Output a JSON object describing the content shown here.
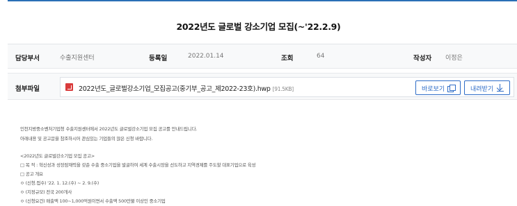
{
  "post": {
    "title": "2022년도 글로벌 강소기업 모집(~'22.2.9)"
  },
  "info": {
    "dept_label": "담당부서",
    "dept_value": "수출지원센터",
    "date_label": "등록일",
    "date_value": "2022.01.14",
    "views_label": "조회",
    "views_value": "64",
    "author_label": "작성자",
    "author_value": "이정은"
  },
  "attachment": {
    "label": "첨부파일",
    "file_name": "2022년도_글로벌강소기업_모집공고(중기부_공고_제2022-23호).hwp",
    "file_size": "[91.5KB]",
    "icon": "hwp-file-icon",
    "view_button": "바로보기",
    "view_icon": "preview-icon",
    "download_button": "내려받기",
    "download_icon": "download-icon"
  },
  "body": {
    "intro_line1": "인천지방중소벤처기업청 수출지원센터에서 2022년도 글로벌강소기업 모집 공고를 안내드립니다.",
    "intro_line2": "아래내용 및 공고문을 참조하시어 관심있는 기업들의 많은 신청 바랍니다.",
    "section_title": "<2022년도 글로벌강소기업 모집 공고>",
    "purpose": "□ 목 적 : 혁신성과 성장잠재력을 갖춘 수출 중소기업을 발굴하여 세계 수출시장을 선도하고 지역경제를 주도할 대표기업으로 육성",
    "overview": "□ 공고 개요",
    "item1": "ㅇ (신청.접수) '22. 1. 12.(수) ~ 2. 9.(수)",
    "item2": "ㅇ (지정규모) 전국 200개사",
    "item3": "ㅇ (신청요건) 매출액 100~1,000억원이면서 수출액 500만불 이상인 중소기업"
  },
  "colors": {
    "accent": "#2e6cc7",
    "top_line": "#2a6fb6",
    "hwp_icon": "#d93b3b",
    "row_bg": "#f8f9fa"
  }
}
